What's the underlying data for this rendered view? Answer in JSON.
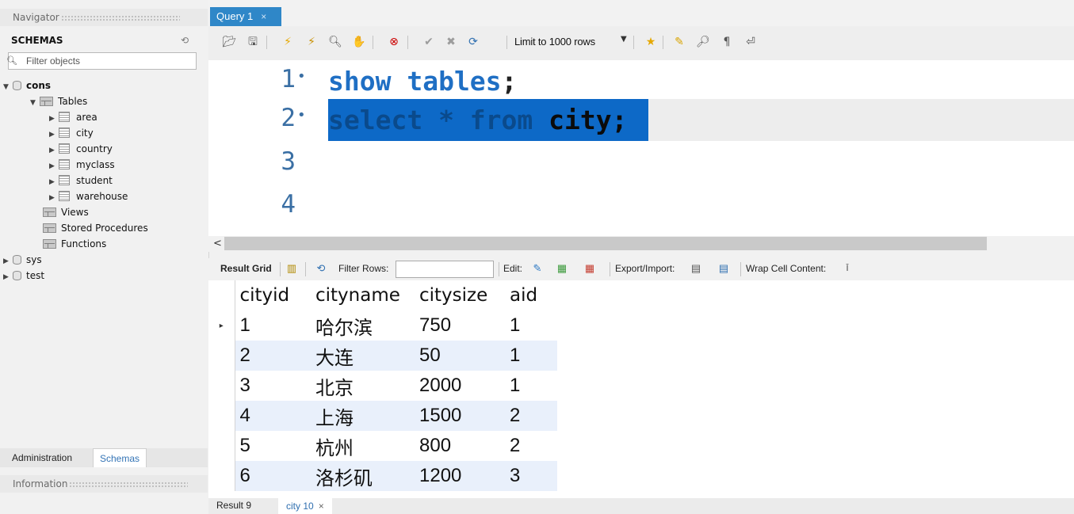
{
  "navigator": {
    "title": "Navigator",
    "schemas_label": "SCHEMAS",
    "filter_placeholder": "Filter objects",
    "tree": {
      "cons": "cons",
      "tables": "Tables",
      "table_items": [
        "area",
        "city",
        "country",
        "myclass",
        "student",
        "warehouse"
      ],
      "views": "Views",
      "stored_procedures": "Stored Procedures",
      "functions": "Functions",
      "sys": "sys",
      "test": "test"
    },
    "tabs": {
      "administration": "Administration",
      "schemas": "Schemas"
    },
    "information_title": "Information"
  },
  "query_tab": {
    "label": "Query 1",
    "close": "×"
  },
  "toolbar": {
    "limit_label": "Limit to 1000 rows"
  },
  "editor": {
    "lines": [
      {
        "num": "1",
        "dot": "•",
        "kw": "show tables",
        "rest": ";"
      },
      {
        "num": "2",
        "dot": "•",
        "kw": "select * from",
        "rest": " city;"
      },
      {
        "num": "3"
      },
      {
        "num": "4"
      }
    ]
  },
  "result_toolbar": {
    "result_grid": "Result Grid",
    "filter_rows": "Filter Rows:",
    "edit": "Edit:",
    "export_import": "Export/Import:",
    "wrap_cell": "Wrap Cell Content:"
  },
  "grid": {
    "columns": [
      "cityid",
      "cityname",
      "citysize",
      "aid"
    ],
    "rows": [
      [
        "1",
        "哈尔滨",
        "750",
        "1"
      ],
      [
        "2",
        "大连",
        "50",
        "1"
      ],
      [
        "3",
        "北京",
        "2000",
        "1"
      ],
      [
        "4",
        "上海",
        "1500",
        "2"
      ],
      [
        "5",
        "杭州",
        "800",
        "2"
      ],
      [
        "6",
        "洛杉矶",
        "1200",
        "3"
      ]
    ],
    "current_row_marker": "▸"
  },
  "result_tabs": {
    "result9": "Result 9",
    "city10": "city 10",
    "close": "×"
  },
  "colors": {
    "accent": "#2f87c8",
    "selection": "#0d69c7",
    "keyword": "#1f6fc4",
    "alt_row": "#e9f0fb"
  }
}
